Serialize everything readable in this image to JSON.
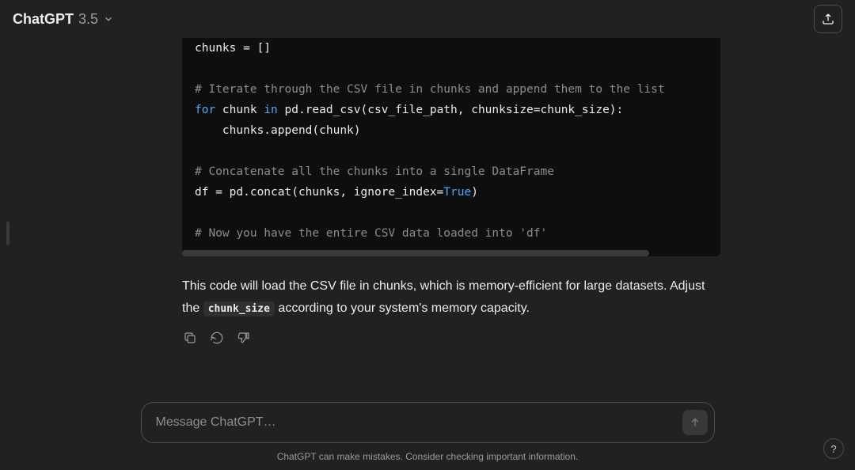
{
  "header": {
    "model_name": "ChatGPT",
    "model_version": "3.5"
  },
  "code": {
    "line_assign": "chunks = []",
    "c_iter": "# Iterate through the CSV file in chunks and append them to the list",
    "kw_for": "for",
    "loop_mid1": " chunk ",
    "kw_in": "in",
    "loop_mid2": " pd.read_csv(csv_file_path, chunksize=chunk_size):",
    "loop_body": "    chunks.append(chunk)",
    "c_concat": "# Concatenate all the chunks into a single DataFrame",
    "concat_pre": "df = pd.concat(chunks, ignore_index=",
    "bool_true": "True",
    "concat_post": ")",
    "c_loaded": "# Now you have the entire CSV data loaded into 'df'"
  },
  "message": {
    "part1": "This code will load the CSV file in chunks, which is memory-efficient for large datasets. Adjust the ",
    "inline": "chunk_size",
    "part2": " according to your system's memory capacity."
  },
  "input": {
    "placeholder": "Message ChatGPT…"
  },
  "footer": {
    "note": "ChatGPT can make mistakes. Consider checking important information."
  },
  "help": {
    "label": "?"
  }
}
